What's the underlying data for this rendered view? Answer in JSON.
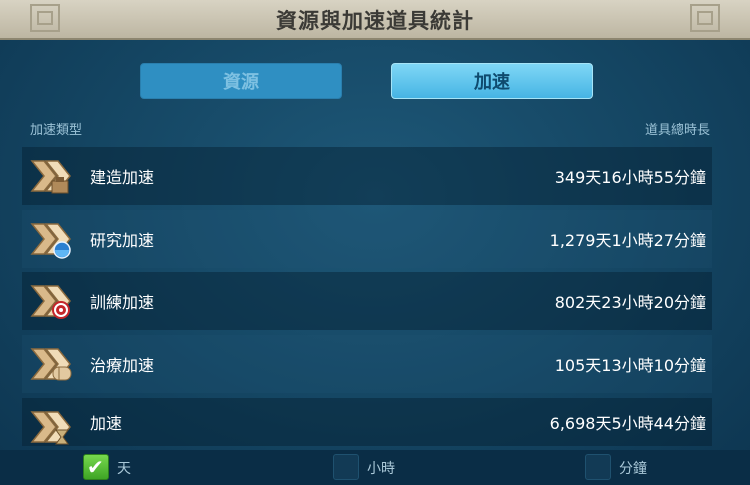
{
  "title": "資源與加速道具統計",
  "tabs": [
    {
      "label": "資源",
      "active": false
    },
    {
      "label": "加速",
      "active": true
    }
  ],
  "columns": {
    "type": "加速類型",
    "total": "道具總時長"
  },
  "rows": [
    {
      "name": "建造加速",
      "value": "349天16小時55分鐘",
      "icon": "build-speedup-icon"
    },
    {
      "name": "研究加速",
      "value": "1,279天1小時27分鐘",
      "icon": "research-speedup-icon"
    },
    {
      "name": "訓練加速",
      "value": "802天23小時20分鐘",
      "icon": "training-speedup-icon"
    },
    {
      "name": "治療加速",
      "value": "105天13小時10分鐘",
      "icon": "healing-speedup-icon"
    },
    {
      "name": "加速",
      "value": "6,698天5小時44分鐘",
      "icon": "universal-speedup-icon"
    }
  ],
  "units": [
    {
      "label": "天",
      "checked": true
    },
    {
      "label": "小時",
      "checked": false
    },
    {
      "label": "分鐘",
      "checked": false
    }
  ],
  "colors": {
    "accent_active": "#46b4e4",
    "check_on": "#3ea525",
    "panel": "#144562"
  }
}
